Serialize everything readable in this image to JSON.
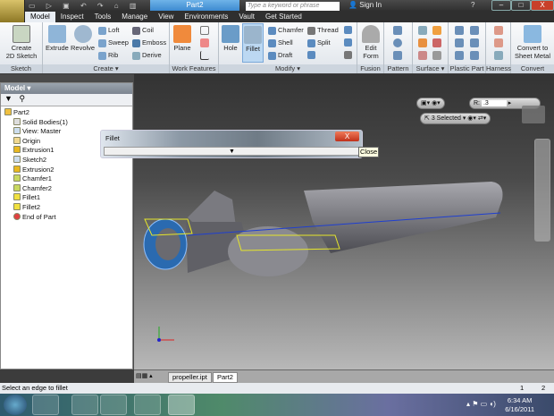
{
  "window": {
    "title": "Part2",
    "search_placeholder": "Type a keyword or phrase",
    "sign_in": "Sign In",
    "help": "?",
    "minimize": "–",
    "maximize": "□",
    "close": "X"
  },
  "tabs": [
    "Model",
    "Inspect",
    "Tools",
    "Manage",
    "View",
    "Environments",
    "Vault",
    "Get Started"
  ],
  "ribbon": {
    "sketch": {
      "label": "Sketch",
      "create_sketch": "Create\n2D Sketch"
    },
    "create": {
      "label": "Create ▾",
      "extrude": "Extrude",
      "revolve": "Revolve",
      "loft": "Loft",
      "sweep": "Sweep",
      "rib": "Rib",
      "coil": "Coil",
      "emboss": "Emboss",
      "derive": "Derive"
    },
    "work_features": {
      "label": "Work Features",
      "plane": "Plane"
    },
    "modify": {
      "label": "Modify ▾",
      "hole": "Hole",
      "fillet": "Fillet",
      "chamfer": "Chamfer",
      "shell": "Shell",
      "draft": "Draft",
      "thread": "Thread",
      "split": "Split"
    },
    "fusion": {
      "label": "Fusion",
      "edit_form": "Edit\nForm"
    },
    "pattern": {
      "label": "Pattern"
    },
    "surface": {
      "label": "Surface ▾"
    },
    "plastic_part": {
      "label": "Plastic Part"
    },
    "harness": {
      "label": "Harness"
    },
    "convert": {
      "label": "Convert",
      "convert_sheet_metal": "Convert to\nSheet Metal"
    }
  },
  "browser": {
    "title": "Model ▾",
    "items": [
      "Part2",
      "Solid Bodies(1)",
      "View: Master",
      "Origin",
      "Extrusion1",
      "Sketch2",
      "Extrusion2",
      "Chamfer1",
      "Chamfer2",
      "Fillet1",
      "Fillet2",
      "End of Part"
    ]
  },
  "fillet_dialog": {
    "title": "Fillet",
    "expand": "▼",
    "close_tooltip": "Close",
    "close": "X"
  },
  "minitoolbar": {
    "radius_label": "R:",
    "radius_value": ".3",
    "selected": "3 Selected"
  },
  "doc_tabs": [
    "propeller.ipt",
    "Part2"
  ],
  "status": {
    "message": "Select an edge to fillet",
    "num1": "1",
    "num2": "2"
  },
  "taskbar": {
    "time": "6:34 AM",
    "date": "6/16/2011"
  },
  "colors": {
    "accent": "#3d8ad0",
    "selection": "#e6e62a",
    "edge": "#1f3fd0"
  }
}
